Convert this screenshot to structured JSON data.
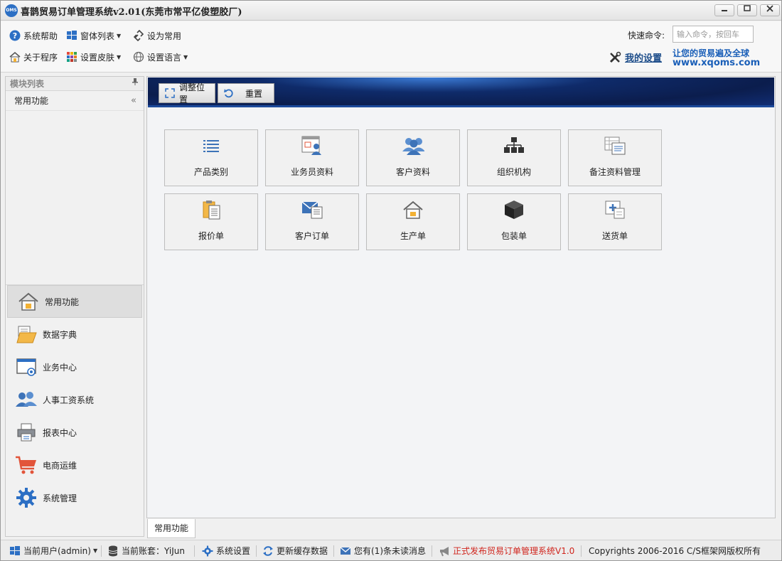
{
  "window": {
    "logo_text": "OMS",
    "title": "喜鹊贸易订单管理系统v2.01(东莞市常平亿俊塑胶厂)",
    "minimize": "▭",
    "maximize": "□",
    "close": "✕"
  },
  "toolbar": {
    "help": "系统帮助",
    "window_list": "窗体列表",
    "set_favorite": "设为常用",
    "about": "关于程序",
    "skin": "设置皮肤",
    "language": "设置语言",
    "command_label": "快速命令:",
    "command_placeholder": "输入命令，按回车",
    "my_settings": "我的设置",
    "brand_slogan": "让您的贸易遍及全球",
    "brand_url": "www.xqoms.com"
  },
  "sidebar": {
    "header": "模块列表",
    "pin": "†",
    "module": "常用功能",
    "collapse": "«",
    "nav": [
      {
        "label": "常用功能",
        "icon": "home-icon"
      },
      {
        "label": "数据字典",
        "icon": "folder-icon"
      },
      {
        "label": "业务中心",
        "icon": "window-eye-icon"
      },
      {
        "label": "人事工资系统",
        "icon": "users-icon"
      },
      {
        "label": "报表中心",
        "icon": "printer-icon"
      },
      {
        "label": "电商运维",
        "icon": "cart-icon"
      },
      {
        "label": "系统管理",
        "icon": "gear-icon"
      }
    ]
  },
  "main": {
    "adjust_button": "调整位置",
    "reset_button": "重置",
    "tiles": [
      {
        "label": "产品类别",
        "icon": "list-icon"
      },
      {
        "label": "业务员资料",
        "icon": "salesperson-icon"
      },
      {
        "label": "客户资料",
        "icon": "customers-icon"
      },
      {
        "label": "组织机构",
        "icon": "org-chart-icon"
      },
      {
        "label": "备注资料管理",
        "icon": "notes-icon"
      },
      {
        "label": "报价单",
        "icon": "clipboard-icon"
      },
      {
        "label": "客户订单",
        "icon": "mail-order-icon"
      },
      {
        "label": "生产单",
        "icon": "house-icon"
      },
      {
        "label": "包装单",
        "icon": "box-icon"
      },
      {
        "label": "送货单",
        "icon": "delivery-icon"
      }
    ],
    "bottom_tab": "常用功能"
  },
  "statusbar": {
    "user": "当前用户(admin)",
    "account": "当前账套：YiJun",
    "settings": "系统设置",
    "refresh_cache": "更新缓存数据",
    "messages": "您有(1)条未读消息",
    "release": "正式发布贸易订单管理系统V1.0",
    "copyright": "Copyrights 2006-2016 C/S框架网版权所有"
  },
  "colors": {
    "accent_blue": "#2c6fc4",
    "banner_dark": "#0b1d4d",
    "release_red": "#d0241c",
    "brand_blue": "#1a5fb8"
  }
}
